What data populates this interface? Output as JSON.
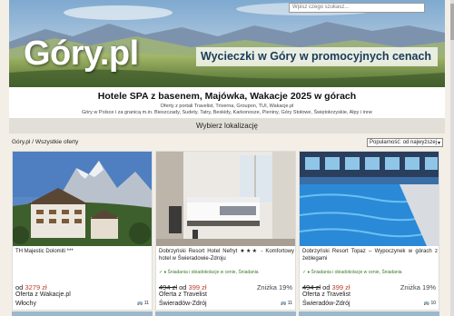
{
  "banner": {
    "search_placeholder": "Wpisz czego szukasz...",
    "logo": "Góry.pl",
    "tagline": "Wycieczki w Góry w promocyjnych cenach"
  },
  "header": {
    "title": "Hotele SPA z basenem, Majówka, Wakacje 2025 w górach",
    "subtitle": "Oferty z portali Travelist, Triverna, Groupon, TUI, Wakacje.pl",
    "regions": "Góry w Polsce i za granicą m.in. Bieszczady, Sudety, Tatry, Beskidy, Karkonosze, Pieniny, Góry Stołowe, Świętokrzyskie, Alpy i inne"
  },
  "location_bar": {
    "label": "Wybierz lokalizację"
  },
  "breadcrumb": "Góry.pl / Wszystkie oferty",
  "sort": {
    "selected": "Popularność: od najwyższej",
    "arrow": "▾"
  },
  "cards": [
    {
      "title": "TH Majestic Dolomiti ***",
      "note": "",
      "price_prefix": "od",
      "old_price": "",
      "new_price": "3279 zł",
      "discount": "",
      "provider": "Oferta z Wakacje.pl",
      "location": "Włochy",
      "count": "11"
    },
    {
      "title": "Dobrzyński Resort Hotel Nefryt ★★★ - Komfortowy hotel w Świeradowie-Zdroju",
      "note": "✓ ♦ Śniadania i obiadokolacje w cenie, Śniadania",
      "price_prefix": "",
      "old_price": "494 zł",
      "new_price_prefix": "od",
      "new_price": "399 zł",
      "discount": "Zniżka 19%",
      "provider": "Oferta z Travelist",
      "location": "Świeradów-Zdrój",
      "count": "11"
    },
    {
      "title": "Dobrzyński Resort Topaz – Wypoczynek w górach z żeblegami",
      "note": "✓ ♦ Śniadania i obiadokolacje w cenie, Śniadania",
      "price_prefix": "",
      "old_price": "494 zł",
      "new_price_prefix": "od",
      "new_price": "399 zł",
      "discount": "Zniżka 19%",
      "provider": "Oferta z Travelist",
      "location": "Świeradów-Zdrój",
      "count": "10"
    }
  ],
  "colors": {
    "accent_price": "#c23a2a",
    "note_green": "#3a7a2a",
    "background": "#f3efe6"
  }
}
